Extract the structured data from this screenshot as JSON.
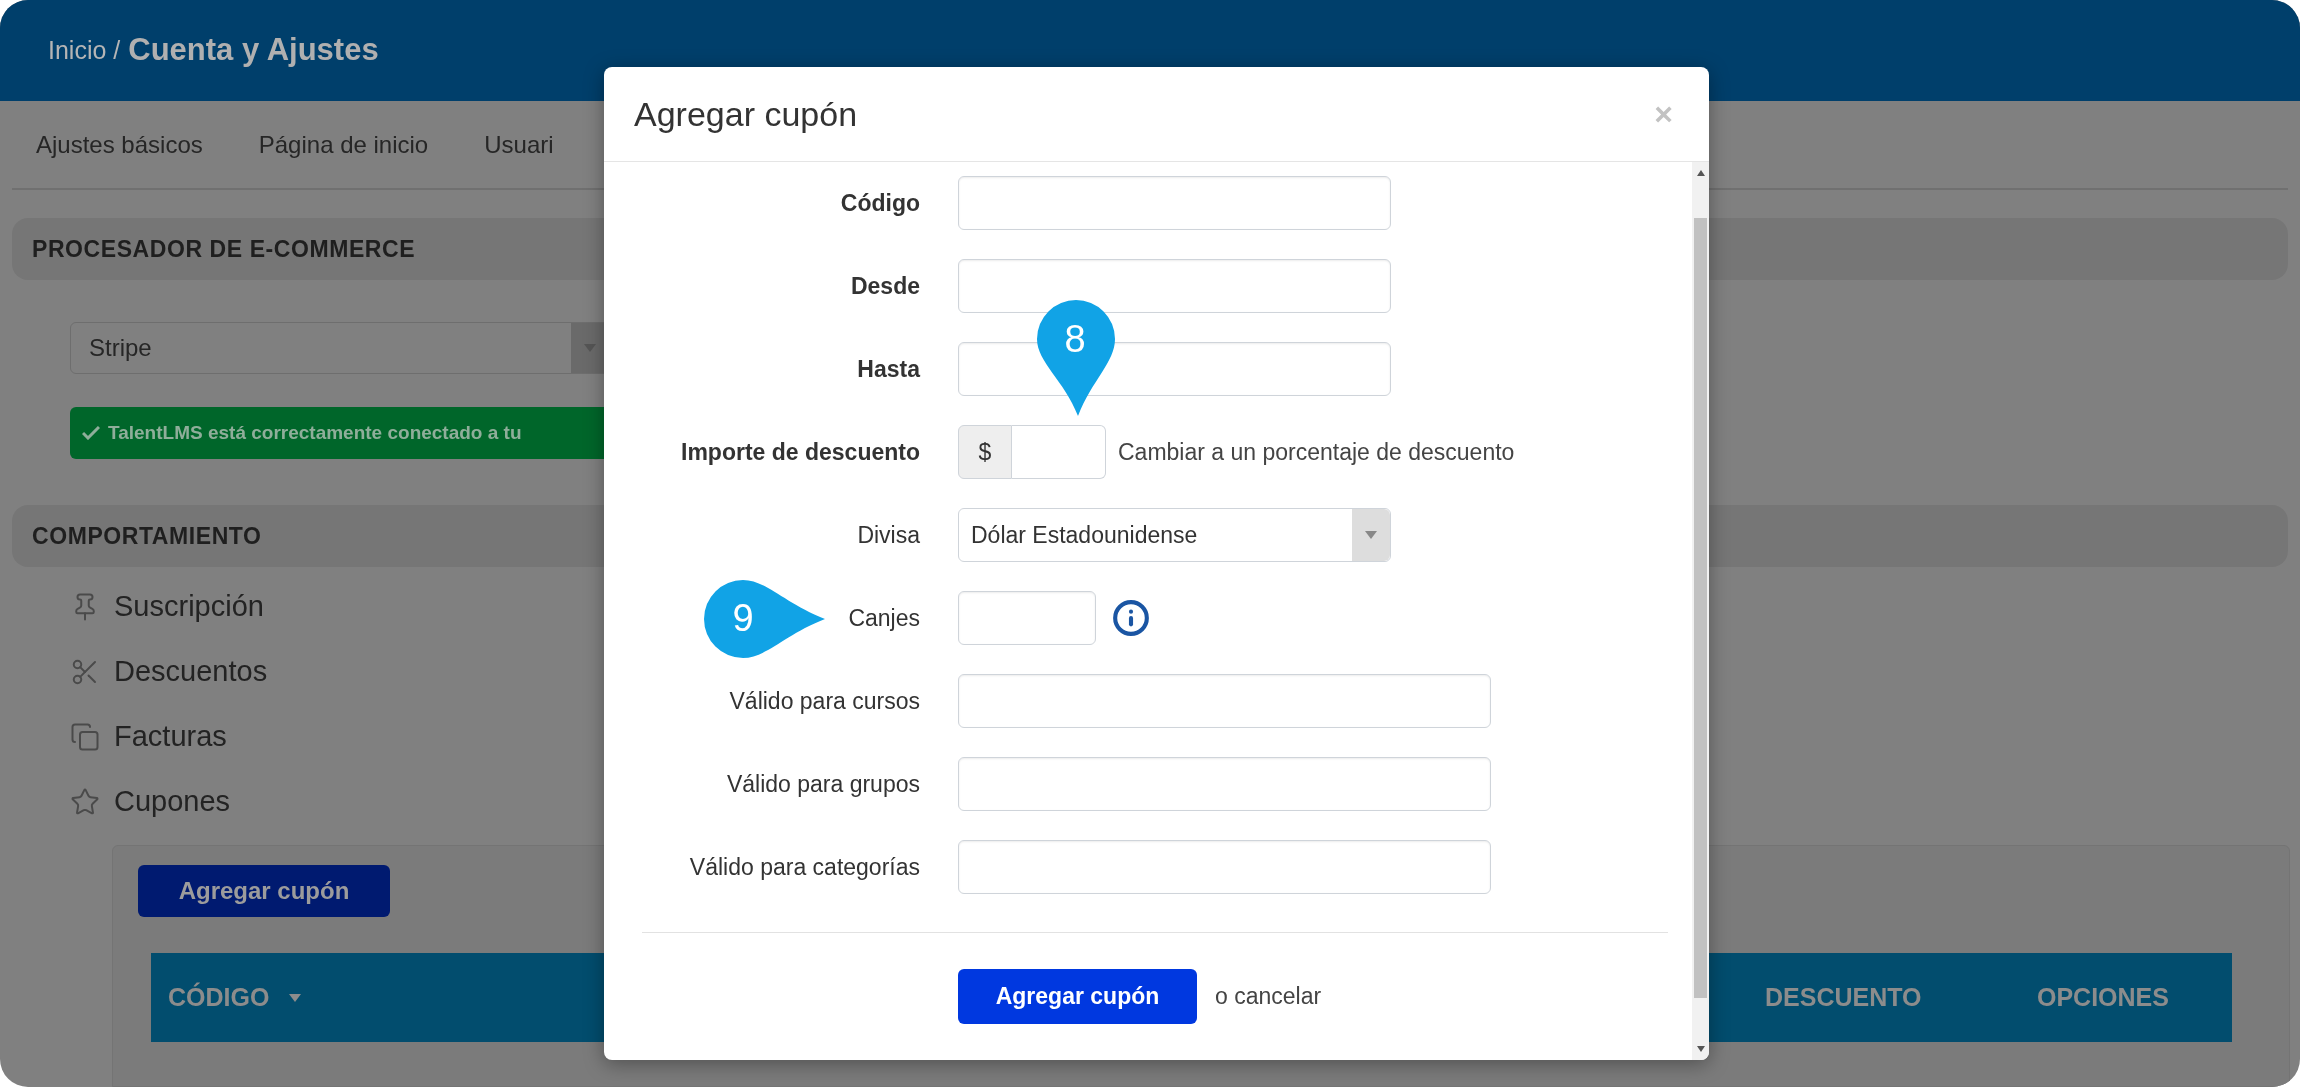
{
  "header": {
    "breadcrumb_parent": "Inicio /",
    "title": "Cuenta y Ajustes"
  },
  "tabs": [
    {
      "label": "Ajustes básicos"
    },
    {
      "label": "Página de inicio"
    },
    {
      "label": "Usuari"
    }
  ],
  "ecommerce": {
    "heading": "PROCESADOR DE E-COMMERCE",
    "processor": "Stripe",
    "alert": "TalentLMS está correctamente conectado a tu"
  },
  "behaviour": {
    "heading": "COMPORTAMIENTO",
    "items": [
      {
        "label": "Suscripción",
        "kind": "pin"
      },
      {
        "label": "Descuentos",
        "kind": "scissors"
      },
      {
        "label": "Facturas",
        "kind": "copy"
      },
      {
        "label": "Cupones",
        "kind": "star"
      }
    ]
  },
  "coupons": {
    "add_button": "Agregar cupón",
    "columns": [
      {
        "label": "CÓDIGO",
        "sortable": true
      },
      {
        "label": "DESCUENTO",
        "sortable": false
      },
      {
        "label": "OPCIONES",
        "sortable": false
      }
    ]
  },
  "modal": {
    "title": "Agregar cupón",
    "close": "×",
    "fields": [
      {
        "label": "Código",
        "kind": "text",
        "required": true
      },
      {
        "label": "Desde",
        "kind": "text",
        "required": true
      },
      {
        "label": "Hasta",
        "kind": "text",
        "required": true
      },
      {
        "label": "Importe de descuento",
        "kind": "amount",
        "required": true,
        "addon": "$",
        "link": "Cambiar a un porcentaje de descuento"
      },
      {
        "label": "Divisa",
        "kind": "select",
        "required": false,
        "value": "Dólar Estadounidense"
      },
      {
        "label": "Canjes",
        "kind": "count",
        "required": false
      },
      {
        "label": "Válido para cursos",
        "kind": "wide",
        "required": false
      },
      {
        "label": "Válido para grupos",
        "kind": "wide",
        "required": false
      },
      {
        "label": "Válido para categorías",
        "kind": "wide",
        "required": false
      }
    ],
    "submit": "Agregar cupón",
    "cancel": "o cancelar"
  },
  "callouts": [
    {
      "label": "8",
      "kind": "down"
    },
    {
      "label": "9",
      "kind": "right"
    }
  ]
}
